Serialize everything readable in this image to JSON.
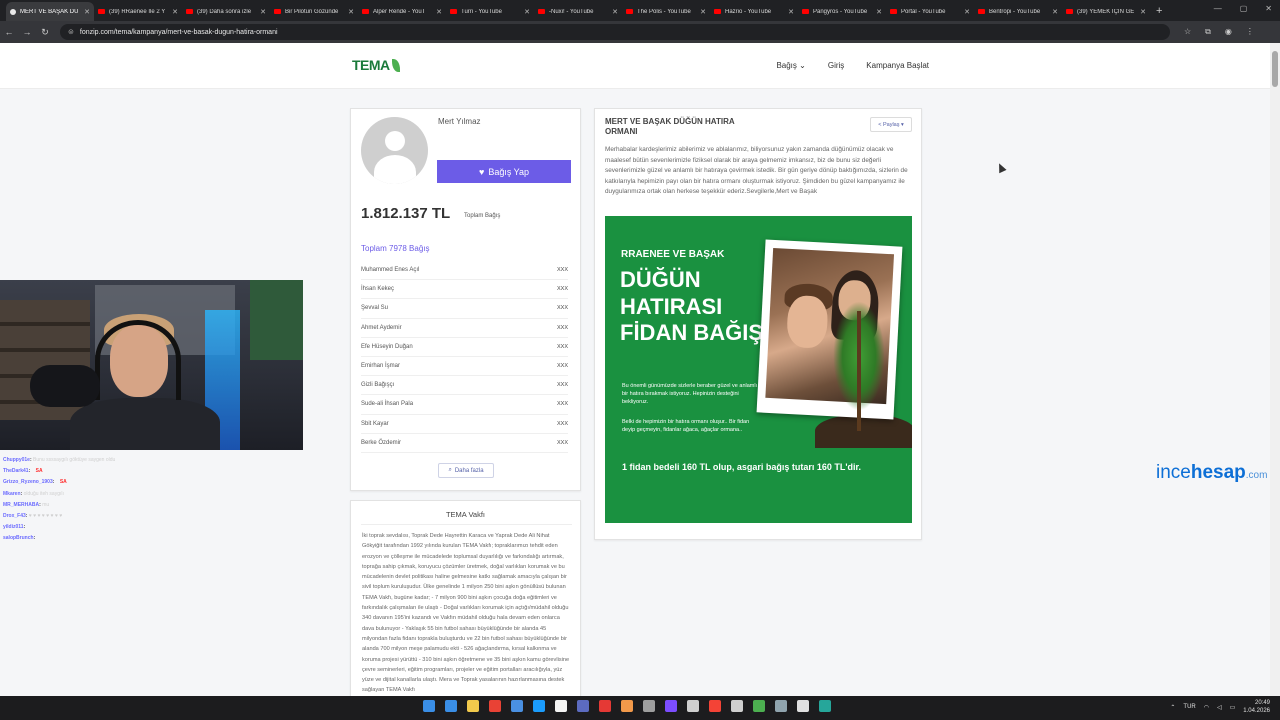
{
  "browser": {
    "tabs": [
      {
        "title": "MERT VE BAŞAK DÜ",
        "active": true
      },
      {
        "title": "(39) RRaenee İle 2 Y"
      },
      {
        "title": "(39) Daha sonra izle"
      },
      {
        "title": "Bir Pilotun Gözünde"
      },
      {
        "title": "Alper Rende - YouT"
      },
      {
        "title": "Turri - YouTube"
      },
      {
        "title": "-Nuxi! - YouTube"
      },
      {
        "title": "The Polis - YouTube"
      },
      {
        "title": "Hazrio - YouTube"
      },
      {
        "title": "Pangyros - YouTube"
      },
      {
        "title": "Portal - YouTube"
      },
      {
        "title": "Bentropi - YouTube"
      },
      {
        "title": "(39) YEMEK İÇİN GE"
      }
    ],
    "url": "fonzip.com/tema/kampanya/mert-ve-basak-dugun-hatira-ormani"
  },
  "site": {
    "logo": "TEMA",
    "nav": {
      "donate": "Bağış",
      "login": "Giriş",
      "start_campaign": "Kampanya Başlat"
    }
  },
  "owner": {
    "name": "Mert Yılmaz",
    "donate_button": "Bağış Yap",
    "total_amount": "1.812.137 TL",
    "total_label": "Toplam Bağış",
    "donors_title": "Toplam 7978 Bağış",
    "donors": [
      {
        "name": "Muhammed Enes Açıl",
        "amount": "XXX"
      },
      {
        "name": "İhsan Kekeç",
        "amount": "XXX"
      },
      {
        "name": "Şevval Su",
        "amount": "XXX"
      },
      {
        "name": "Ahmet Aydemir",
        "amount": "XXX"
      },
      {
        "name": "Efe Hüseyin Duğan",
        "amount": "XXX"
      },
      {
        "name": "Emirhan İşmar",
        "amount": "XXX"
      },
      {
        "name": "Gizli Bağışçı",
        "amount": "XXX"
      },
      {
        "name": "Sude-ali İhsan Pala",
        "amount": "XXX"
      },
      {
        "name": "Sbit Kayar",
        "amount": "XXX"
      },
      {
        "name": "Berke Özdemir",
        "amount": "XXX"
      }
    ],
    "more_button": "Daha fazla"
  },
  "tema": {
    "title": "TEMA Vakfı",
    "body": "İki toprak sevdalısı, Toprak Dede Hayrettin Karaca ve Yaprak Dede Ali Nihat Gökyiğit tarafından 1992 yılında kurulan TEMA Vakfı; topraklarımızı tehdit eden erozyon ve çölleşme ile mücadelede toplumsal duyarlılığı ve farkındalığı artırmak, toprağa sahip çıkmak, koruyucu çözümler üretmek, doğal varlıkları korumak ve bu mücadelenin devlet politikası haline gelmesine katkı sağlamak amacıyla çalışan bir sivil toplum kuruluşudur. Ülke genelinde 1 milyon 250 bini aşkın gönüllüsü bulunan TEMA Vakfı, bugüne kadar; - 7 milyon 900 bini aşkın çocuğa doğa eğitimleri ve farkındalık çalışmaları ile ulaştı - Doğal varlıkları korumak için açtığı/müdahil olduğu 340 davanın 195'ini kazandı ve Vakfın müdahil olduğu hala devam eden onlarca dava bulunuyor - Yaklaşık 55 bin futbol sahası büyüklüğünde bir alanda 45 milyondan fazla fidanı toprakla buluşturdu ve 22 bin futbol sahası büyüklüğünde bir alanda 700 milyon meşe palamudu ekti - 526 ağaçlandırma, kırsal kalkınma ve koruma projesi yürüttü - 310 bini aşkın öğretmene ve 35 bini aşkın kamu görevlisine çevre seminerleri, eğitim programları, projeler ve eğitim portalları aracılığıyla, yüz yüze ve dijital kanallarla ulaştı. Mera ve Toprak yasalarının hazırlanmasına destek sağlayan TEMA Vakfı"
  },
  "campaign": {
    "title": "MERT VE BAŞAK DÜĞÜN HATIRA ORMANI",
    "share_button": "Paylaş",
    "description": "Merhabalar kardeşlerimiz abilerimiz ve ablalarımız, biliyorsunuz yakın zamanda düğünümüz olacak ve maalesef bütün sevenlerimizle fiziksel olarak bir araya gelmemiz imkansız, biz de bunu siz değerli sevenlerimizle güzel ve anlamlı bir hatıraya  çevirmek istedik. Bir gün geriye dönüp baktığımızda, sizlerin de katkılarıyla hepimizin payı olan bir hatıra ormanı oluşturmak istiyoruz. Şimdiden bu güzel kampanyamız ile duygularımıza ortak olan herkese teşekkür ederiz.Sevgilerle,Mert ve Başak",
    "banner": {
      "small_title": "RRAENEE VE BAŞAK",
      "big_title": "DÜĞÜN HATIRASI FİDAN BAĞIŞI",
      "text1": "Bu önemli günümüzde sizlerle beraber güzel ve anlamlı bir hatıra bırakmak istiyoruz. Hepinizin desteğini bekliyoruz.",
      "text2": "Belki de hepimizin bir hatıra ormanı oluşur.. Bir fidan deyip geçmeyin, fidanlar ağaca, ağaçlar ormana..",
      "price_text": "1 fidan bedeli 160 TL olup, asgari bağış tutarı 160 TL'dir."
    }
  },
  "stream": {
    "chat": [
      {
        "user": "Chuppy01e",
        "message": "Bunu ssssaygılı göktüye saygen oldu",
        "highlight": ""
      },
      {
        "user": "TheDark41",
        "message": "",
        "highlight": "SA"
      },
      {
        "user": "Grizzo_Ryzeno_1903",
        "message": "",
        "highlight": "SA"
      },
      {
        "user": "Mkaren",
        "message": "olduğu iteh saygılı",
        "highlight": ""
      },
      {
        "user": "MR_MERHABA",
        "message": "mu",
        "highlight": ""
      },
      {
        "user": "Drox_F43",
        "message": "♥ ♥ ♥ ♥ ♥ ♥ ♥ ♥",
        "highlight": ""
      },
      {
        "user": "yildiz011",
        "message": "",
        "highlight": ""
      },
      {
        "user": "salopBrunch",
        "message": "",
        "highlight": ""
      }
    ],
    "sponsor": {
      "main": "ince",
      "bold": "hesap",
      "suffix": ".com"
    }
  },
  "taskbar": {
    "time": "20:49",
    "date": "1.04.2026",
    "language": "TUR"
  },
  "colors": {
    "accent": "#6c5ce7",
    "banner_green": "#1a9140",
    "tema_green": "#1a7a3a"
  }
}
